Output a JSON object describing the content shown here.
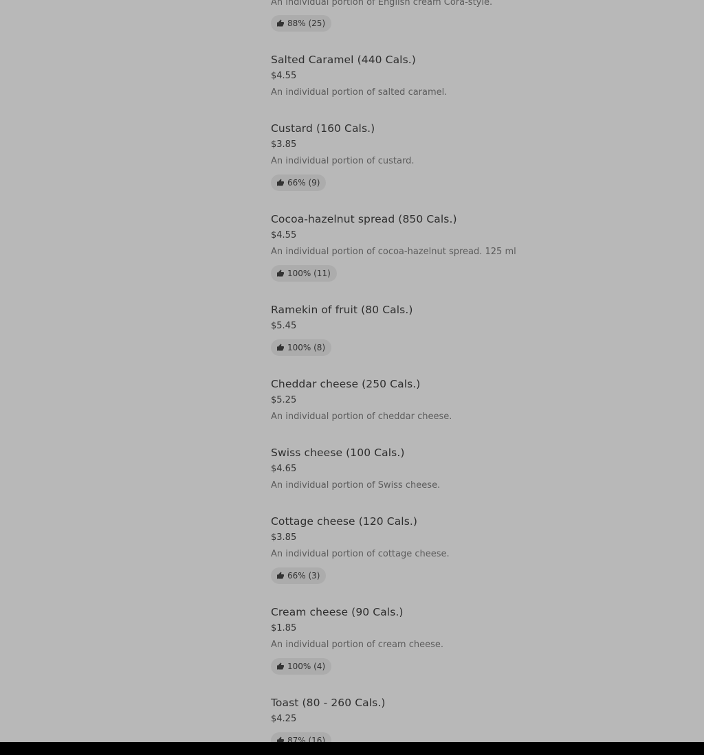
{
  "colors": {
    "background": "#b8b8b8",
    "badge_bg": "#acacac",
    "title_text": "#2e2e2e",
    "desc_text": "#5c5c5c",
    "bottom_bar": "#000000"
  },
  "icons": {
    "rating": "thumbs-up-icon"
  },
  "top_item": {
    "description": "An individual portion of English cream Cora-style.",
    "rating": "88% (25)"
  },
  "items": [
    {
      "name": "Salted Caramel (440 Cals.)",
      "price": "$4.55",
      "description": "An individual portion of salted caramel."
    },
    {
      "name": "Custard (160 Cals.)",
      "price": "$3.85",
      "description": "An individual portion of custard.",
      "rating": "66% (9)"
    },
    {
      "name": "Cocoa-hazelnut spread (850 Cals.)",
      "price": "$4.55",
      "description": "An individual portion of cocoa-hazelnut spread. 125 ml",
      "rating": "100% (11)"
    },
    {
      "name": "Ramekin of fruit (80 Cals.)",
      "price": "$5.45",
      "rating": "100% (8)"
    },
    {
      "name": "Cheddar cheese (250 Cals.)",
      "price": "$5.25",
      "description": "An individual portion of cheddar cheese."
    },
    {
      "name": "Swiss cheese (100 Cals.)",
      "price": "$4.65",
      "description": "An individual portion of Swiss cheese."
    },
    {
      "name": "Cottage cheese (120 Cals.)",
      "price": "$3.85",
      "description": "An individual portion of cottage cheese.",
      "rating": "66% (3)"
    },
    {
      "name": "Cream cheese (90 Cals.)",
      "price": "$1.85",
      "description": "An individual portion of cream cheese.",
      "rating": "100% (4)"
    },
    {
      "name": "Toast (80 - 260 Cals.)",
      "price": "$4.25",
      "rating": "87% (16)"
    }
  ]
}
